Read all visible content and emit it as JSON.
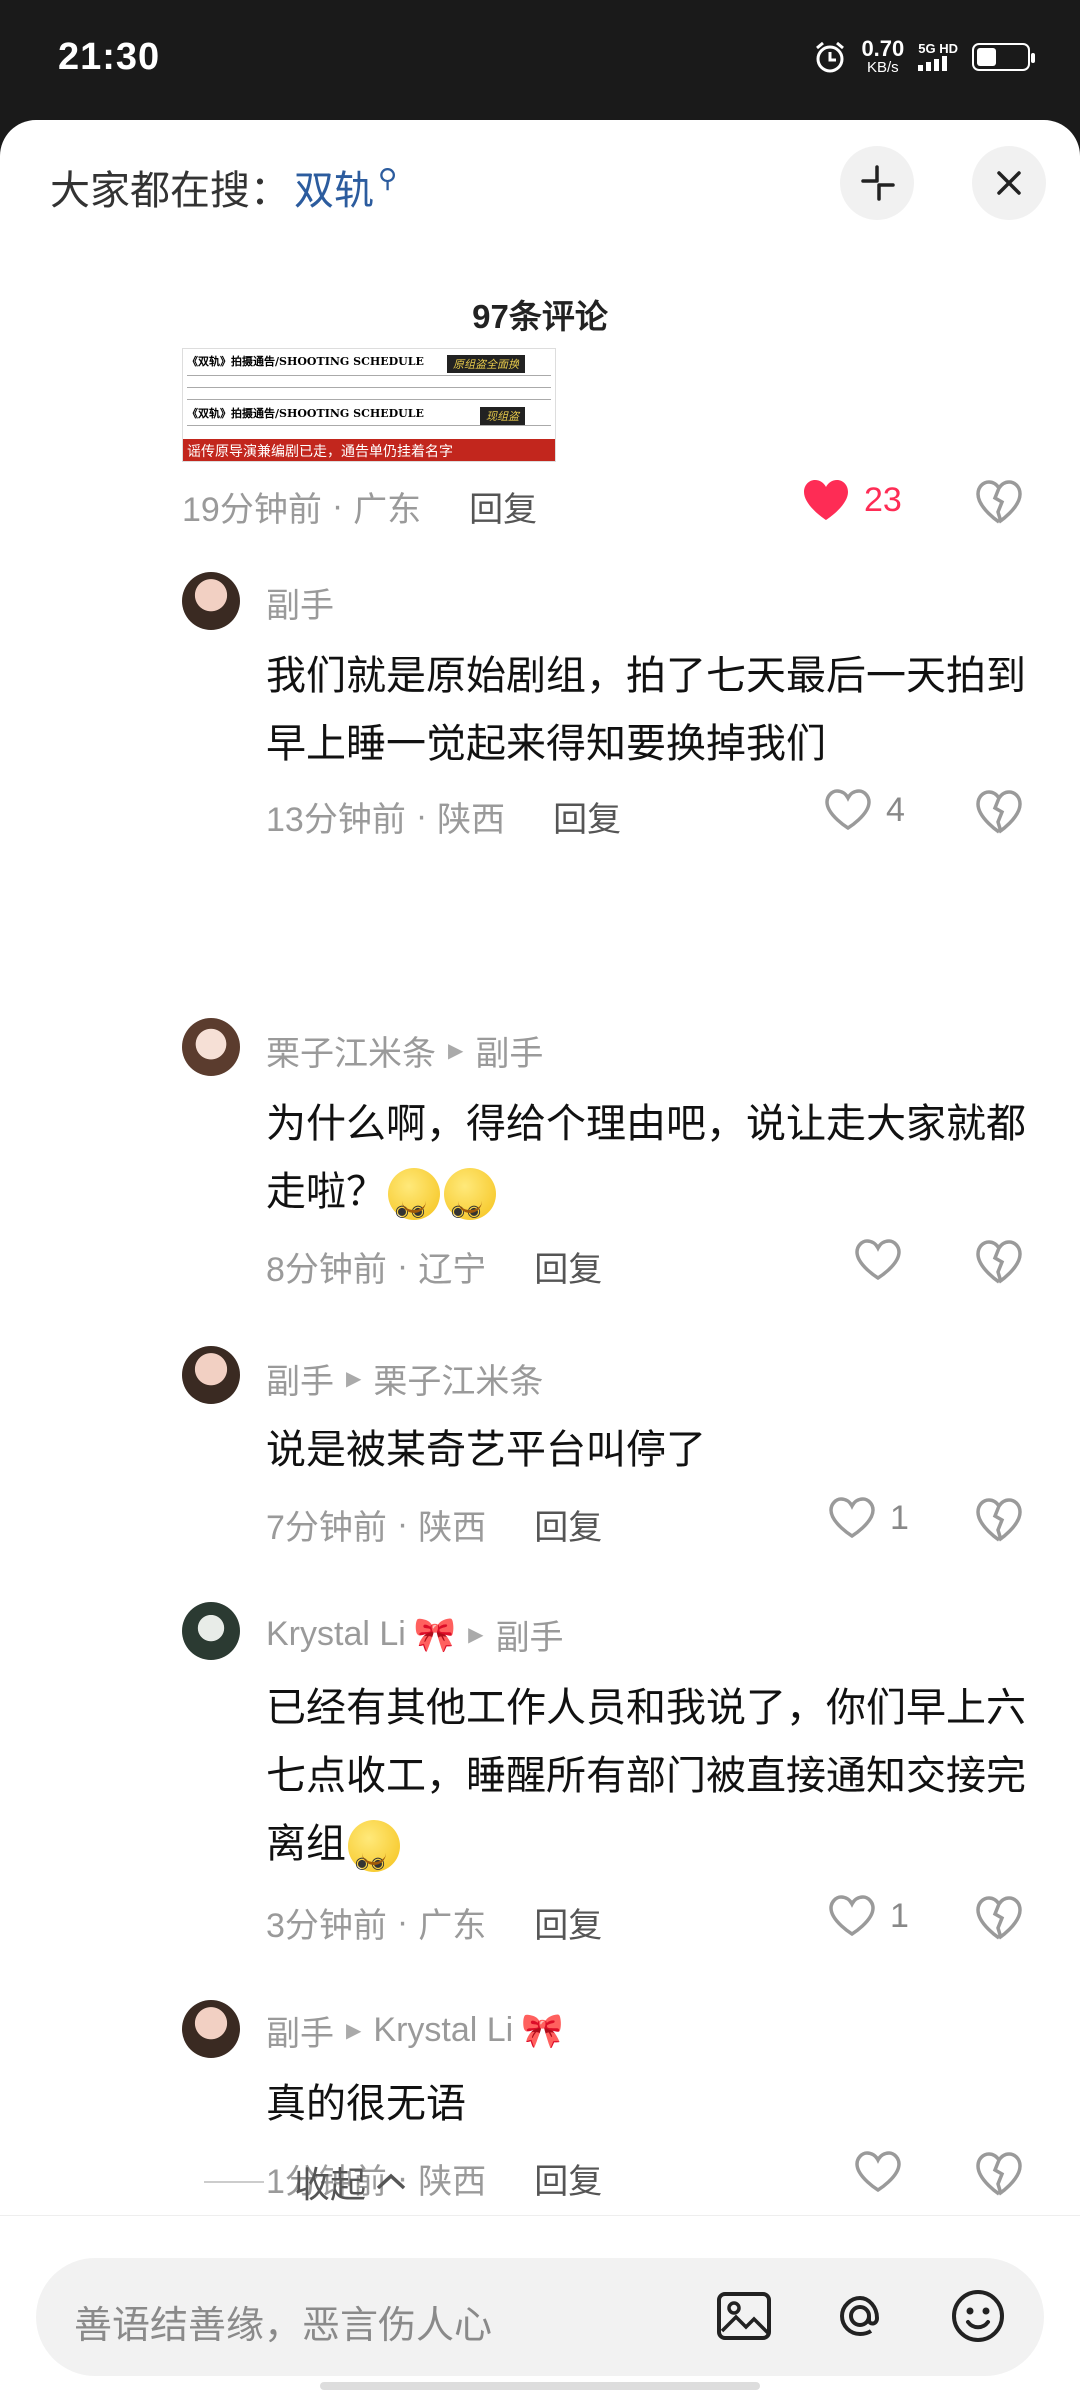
{
  "status_bar": {
    "time": "21:30",
    "net_speed": "0.70",
    "net_unit": "KB/s",
    "network": "5G HD"
  },
  "header": {
    "search_prefix": "大家都在搜：",
    "search_keyword": "双轨"
  },
  "comments_count": "97条评论",
  "thumbnail": {
    "line1": "《双轨》拍摄通告/SHOOTING SCHEDULE",
    "line2": "《双轨》拍摄通告/SHOOTING SCHEDULE",
    "tag1": "原组盗全面换",
    "tag2": "现组盗",
    "red_text": "谣传原导演兼编剧已走，通告单仍挂着名字"
  },
  "top_comment": {
    "time": "19分钟前",
    "location": "广东",
    "reply": "回复",
    "likes": "23"
  },
  "replies": [
    {
      "user": "副手",
      "reply_to": "",
      "text": "我们就是原始剧组，拍了七天最后一天拍到早上睡一觉起来得知要换掉我们",
      "time": "13分钟前",
      "location": "陕西",
      "reply": "回复",
      "likes": "4"
    },
    {
      "user": "栗子江米条",
      "reply_to": "副手",
      "text": "为什么啊，得给个理由吧，说让走大家就都走啦？",
      "time": "8分钟前",
      "location": "辽宁",
      "reply": "回复",
      "likes": ""
    },
    {
      "user": "副手",
      "reply_to": "栗子江米条",
      "text": "说是被某奇艺平台叫停了",
      "time": "7分钟前",
      "location": "陕西",
      "reply": "回复",
      "likes": "1"
    },
    {
      "user": "Krystal Li",
      "reply_to": "副手",
      "text": "已经有其他工作人员和我说了，你们早上六七点收工，睡醒所有部门被直接通知交接完离组",
      "time": "3分钟前",
      "location": "广东",
      "reply": "回复",
      "likes": "1"
    },
    {
      "user": "副手",
      "reply_to": "Krystal Li",
      "text": "真的很无语",
      "time": "1分钟前",
      "location": "陕西",
      "reply": "回复",
      "likes": ""
    }
  ],
  "collapse_label": "收起",
  "input": {
    "placeholder": "善语结善缘，恶言伤人心"
  },
  "colors": {
    "like_red": "#fe2c55",
    "link_blue": "#2c5c9e"
  }
}
